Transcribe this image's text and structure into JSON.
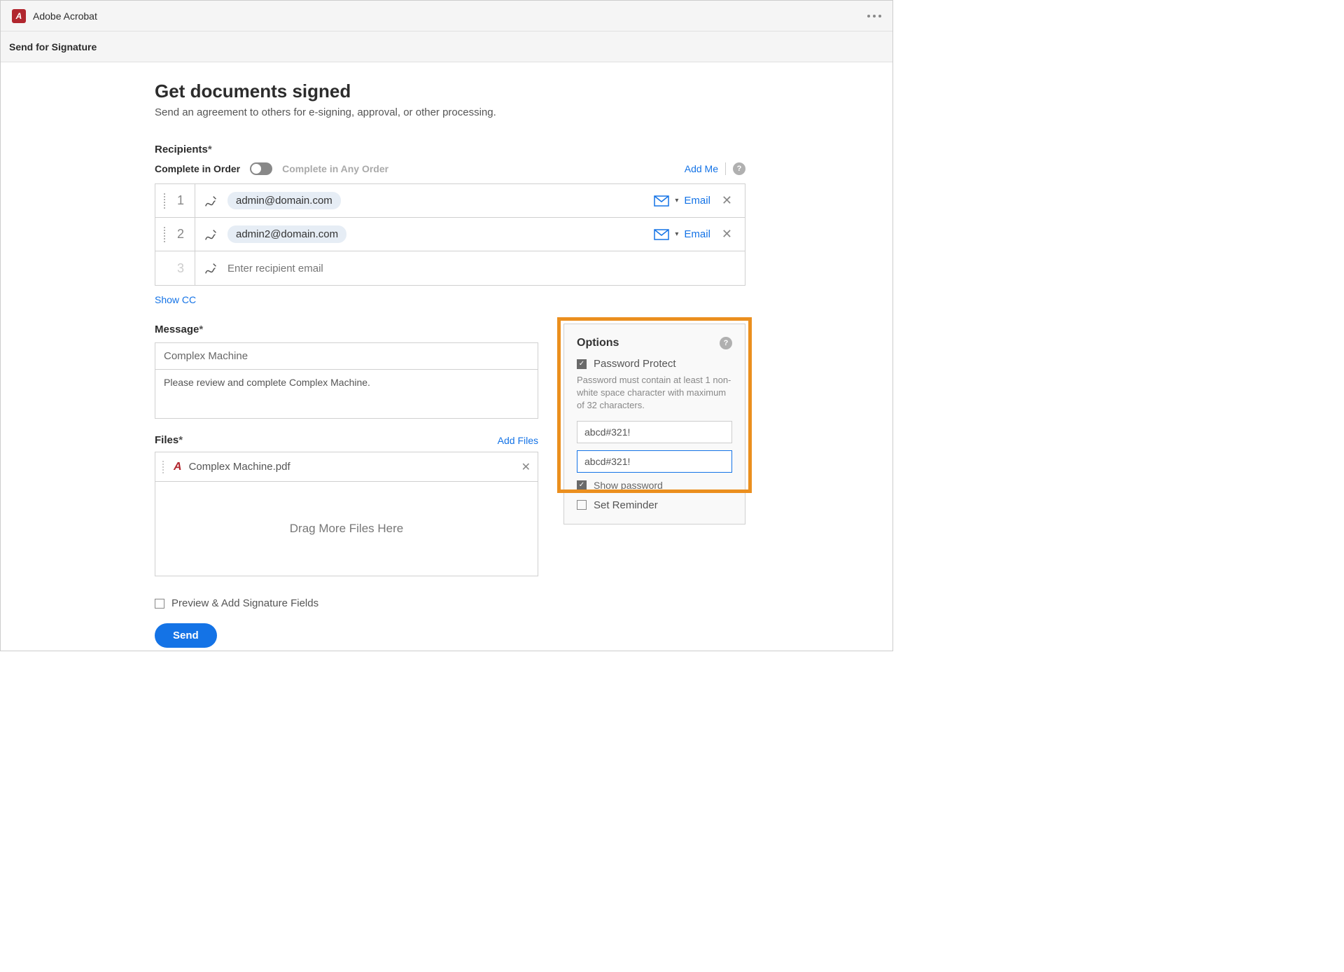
{
  "titlebar": {
    "app_name": "Adobe Acrobat"
  },
  "subbar": {
    "title": "Send for Signature"
  },
  "header": {
    "title": "Get documents signed",
    "subtitle": "Send an agreement to others for e-signing, approval, or other processing."
  },
  "recipients": {
    "label": "Recipients",
    "asterisk": "*",
    "complete_in_order": "Complete in Order",
    "complete_any_order": "Complete in Any Order",
    "add_me": "Add Me",
    "rows": [
      {
        "num": "1",
        "email": "admin@domain.com",
        "method": "Email"
      },
      {
        "num": "2",
        "email": "admin2@domain.com",
        "method": "Email"
      },
      {
        "num": "3",
        "placeholder": "Enter recipient email"
      }
    ],
    "show_cc": "Show CC"
  },
  "message": {
    "label": "Message",
    "asterisk": "*",
    "subject": "Complex Machine",
    "body": "Please review and complete Complex Machine."
  },
  "files": {
    "label": "Files",
    "asterisk": "*",
    "add_files": "Add Files",
    "items": [
      {
        "name": "Complex Machine.pdf"
      }
    ],
    "dropzone": "Drag More Files Here"
  },
  "options": {
    "title": "Options",
    "password_protect": "Password Protect",
    "pw_desc": "Password must contain at least 1 non-white space character with maximum of 32 characters.",
    "pw1": "abcd#321!",
    "pw2": "abcd#321!",
    "show_password": "Show password",
    "set_reminder": "Set Reminder"
  },
  "footer": {
    "preview": "Preview & Add Signature Fields",
    "send": "Send"
  }
}
